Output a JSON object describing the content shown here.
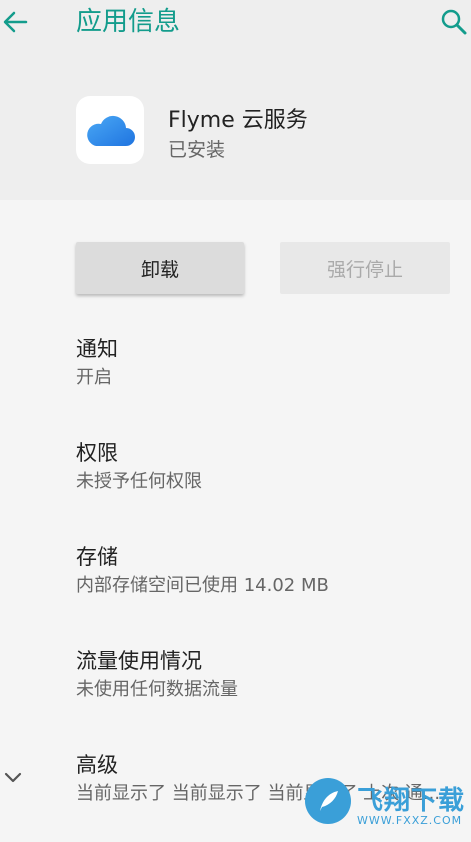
{
  "header": {
    "title": "应用信息",
    "back_icon": "arrow-left-icon",
    "search_icon": "search-icon",
    "accent_color": "#139c8c"
  },
  "app": {
    "icon": "cloud-icon",
    "name": "Flyme 云服务",
    "status": "已安装"
  },
  "actions": {
    "uninstall_label": "卸载",
    "force_stop_label": "强行停止"
  },
  "settings": [
    {
      "title": "通知",
      "subtitle": "开启"
    },
    {
      "title": "权限",
      "subtitle": "未授予任何权限"
    },
    {
      "title": "存储",
      "subtitle": "内部存储空间已使用 14.02 MB"
    },
    {
      "title": "流量使用情况",
      "subtitle": "未使用任何数据流量"
    },
    {
      "title": "高级",
      "subtitle": "当前显示了 当前显示了 当前显示了 上次 通..."
    }
  ],
  "expand_icon": "chevron-down-icon",
  "watermark": {
    "text": "飞翔下载",
    "url": "WWW.FXXZ.COM"
  }
}
